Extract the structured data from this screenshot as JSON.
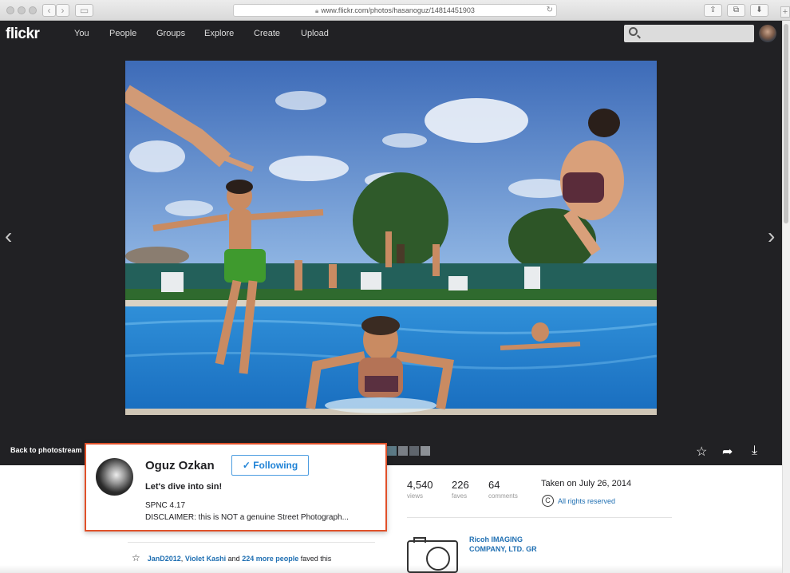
{
  "browser": {
    "url": "www.flickr.com/photos/hasanoguz/14814451903"
  },
  "header": {
    "logo": "flickr",
    "nav": [
      "You",
      "People",
      "Groups",
      "Explore",
      "Create",
      "Upload"
    ],
    "search_placeholder": ""
  },
  "stage": {
    "back_link": "Back to photostream"
  },
  "popover": {
    "name": "Oguz Ozkan",
    "follow_label": "✓ Following",
    "title": "Let's dive into sin!",
    "desc_line1": "SPNC 4.17",
    "desc_line2": "DISCLAIMER: this is NOT a genuine Street Photograph..."
  },
  "stats": [
    {
      "num": "4,540",
      "label": "views"
    },
    {
      "num": "226",
      "label": "faves"
    },
    {
      "num": "64",
      "label": "comments"
    }
  ],
  "taken": "Taken on July 26, 2014",
  "rights": "All rights reserved",
  "camera": "Ricoh IMAGING COMPANY, LTD. GR",
  "faves": {
    "user1": "JanD2012",
    "sep": ", ",
    "user2": "Violet Kashi",
    "and": " and ",
    "more": "224 more people",
    "suffix": " faved this"
  },
  "colors": {
    "popover_border": "#e0512a",
    "link": "#1f6fb2",
    "follow": "#1f82d6",
    "header_bg": "#212124"
  }
}
